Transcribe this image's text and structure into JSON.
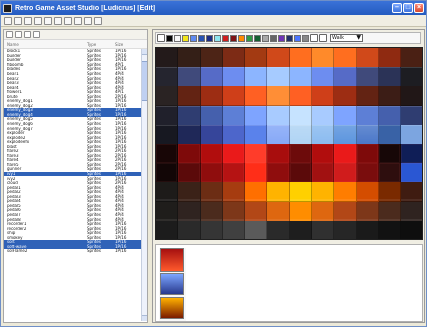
{
  "window": {
    "title": "Retro Game Asset Studio [Ludicrus] [Edit]"
  },
  "left_panel": {
    "headers": {
      "name": "Name",
      "type": "Type",
      "size": "Size"
    },
    "rows": [
      {
        "name": "block1",
        "type": "Sprites",
        "size": "1P/16",
        "selected": false
      },
      {
        "name": "builder",
        "type": "Sprites",
        "size": "1P/16",
        "selected": false
      },
      {
        "name": "builder",
        "type": "Sprites",
        "size": "1P/16",
        "selected": false
      },
      {
        "name": "fiboomb",
        "type": "Sprites",
        "size": "4P/1",
        "selected": false
      },
      {
        "name": "blades",
        "type": "Sprites",
        "size": "1P/16",
        "selected": false
      },
      {
        "name": "bear1",
        "type": "Sprites",
        "size": "4P/4",
        "selected": false
      },
      {
        "name": "bear2",
        "type": "Sprites",
        "size": "4P/4",
        "selected": false
      },
      {
        "name": "bear3",
        "type": "Sprites",
        "size": "4P/4",
        "selected": false
      },
      {
        "name": "bear4",
        "type": "Sprites",
        "size": "4P/4",
        "selected": false
      },
      {
        "name": "flower1",
        "type": "Sprites",
        "size": "4P/1",
        "selected": false
      },
      {
        "name": "brute",
        "type": "Sprites",
        "size": "2P/16",
        "selected": false
      },
      {
        "name": "enemy_dog1",
        "type": "Sprites",
        "size": "1P/16",
        "selected": false
      },
      {
        "name": "enemy_dog2",
        "type": "Sprites",
        "size": "1P/16",
        "selected": false
      },
      {
        "name": "enemy_dog3",
        "type": "Sprites",
        "size": "1P/16",
        "selected": true
      },
      {
        "name": "enemy_dog4",
        "type": "Sprites",
        "size": "1P/16",
        "selected": true
      },
      {
        "name": "enemy_dog5",
        "type": "Sprites",
        "size": "1P/16",
        "selected": false
      },
      {
        "name": "enemy_dog6",
        "type": "Sprites",
        "size": "1P/16",
        "selected": false
      },
      {
        "name": "enemy_dog7",
        "type": "Sprites",
        "size": "1P/16",
        "selected": false
      },
      {
        "name": "exploder",
        "type": "Sprites",
        "size": "1P/16",
        "selected": false
      },
      {
        "name": "explode2",
        "type": "Sprites",
        "size": "1P/16",
        "selected": false
      },
      {
        "name": "explodeefx",
        "type": "Sprites",
        "size": "1P/16",
        "selected": false
      },
      {
        "name": "blast",
        "type": "Sprites",
        "size": "1P/16",
        "selected": false
      },
      {
        "name": "flare2",
        "type": "Sprites",
        "size": "2P/16",
        "selected": false
      },
      {
        "name": "flare3",
        "type": "Sprites",
        "size": "2P/16",
        "selected": false
      },
      {
        "name": "flare4",
        "type": "Sprites",
        "size": "2P/16",
        "selected": false
      },
      {
        "name": "flare5",
        "type": "Sprites",
        "size": "2P/16",
        "selected": false
      },
      {
        "name": "gunner",
        "type": "Sprites",
        "size": "2P/16",
        "selected": false
      },
      {
        "name": "ivy1",
        "type": "Sprites",
        "size": "1P/16",
        "selected": true
      },
      {
        "name": "ivy2",
        "type": "Sprites",
        "size": "1P/16",
        "selected": false
      },
      {
        "name": "cloud",
        "type": "Sprites",
        "size": "2P/16",
        "selected": false
      },
      {
        "name": "pedal1",
        "type": "Sprites",
        "size": "4P/4",
        "selected": false
      },
      {
        "name": "pedal2",
        "type": "Sprites",
        "size": "4P/4",
        "selected": false
      },
      {
        "name": "pedal3",
        "type": "Sprites",
        "size": "4P/4",
        "selected": false
      },
      {
        "name": "pedal4",
        "type": "Sprites",
        "size": "4P/4",
        "selected": false
      },
      {
        "name": "pedal5",
        "type": "Sprites",
        "size": "4P/4",
        "selected": false
      },
      {
        "name": "pedal6",
        "type": "Sprites",
        "size": "4P/4",
        "selected": false
      },
      {
        "name": "pedal7",
        "type": "Sprites",
        "size": "4P/4",
        "selected": false
      },
      {
        "name": "pedal8",
        "type": "Sprites",
        "size": "4P/4",
        "selected": false
      },
      {
        "name": "recorder1",
        "type": "Sprites",
        "size": "1P/16",
        "selected": false
      },
      {
        "name": "recorder2",
        "type": "Sprites",
        "size": "1P/16",
        "selected": false
      },
      {
        "name": "ship",
        "type": "Sprites",
        "size": "1P/16",
        "selected": false
      },
      {
        "name": "smokey",
        "type": "Sprites",
        "size": "1P/16",
        "selected": false
      },
      {
        "name": "sort",
        "type": "Sprites",
        "size": "1P/16",
        "selected": true
      },
      {
        "name": "soft-wave",
        "type": "Sprites",
        "size": "1P/16",
        "selected": true
      },
      {
        "name": "solFlame2",
        "type": "Sprites",
        "size": "1P/16",
        "selected": false
      }
    ]
  },
  "palette": {
    "zoom_value": "Walk"
  }
}
